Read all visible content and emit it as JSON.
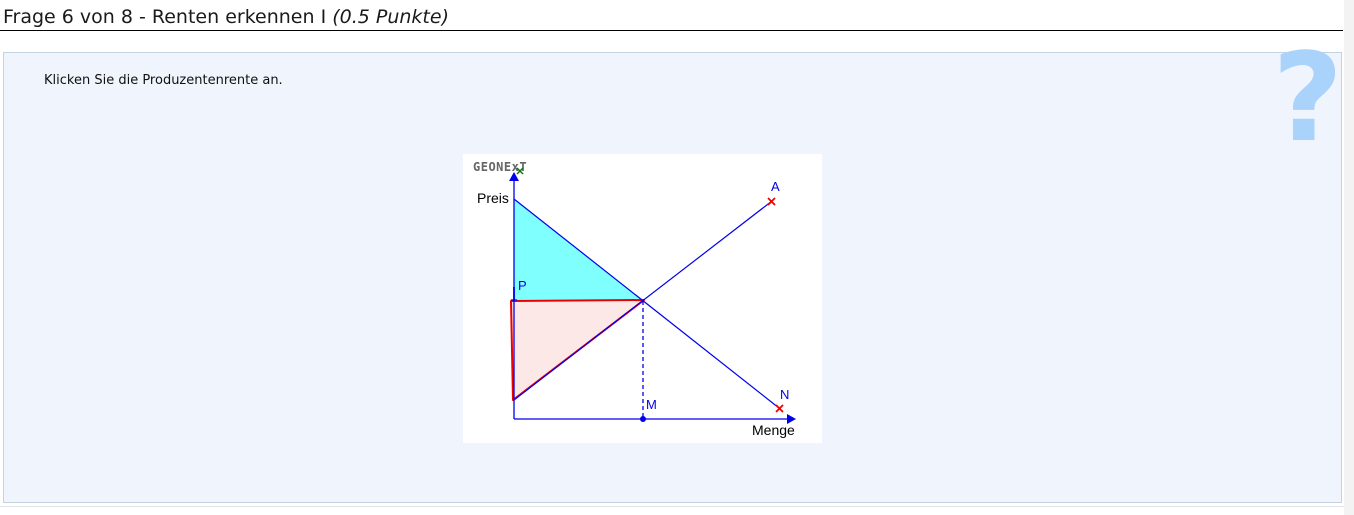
{
  "header": {
    "title": "Frage 6 von 8 - Renten erkennen I",
    "points": "(0.5 Punkte)"
  },
  "question": {
    "instruction": "Klicken Sie die Produzentenrente an.",
    "help_icon": "?"
  },
  "applet": {
    "logo": "GEONExT",
    "y_axis_label": "Preis",
    "x_axis_label": "Menge",
    "point_labels": {
      "price": "P",
      "quantity": "M",
      "supply_end": "A",
      "demand_end": "N"
    },
    "colors": {
      "axes": "#0000ee",
      "consumer_surplus_fill": "#80ffff",
      "producer_surplus_fill": "#fde8e8",
      "producer_surplus_stroke": "#ee0000",
      "handle_markers": "#ee0000"
    }
  }
}
